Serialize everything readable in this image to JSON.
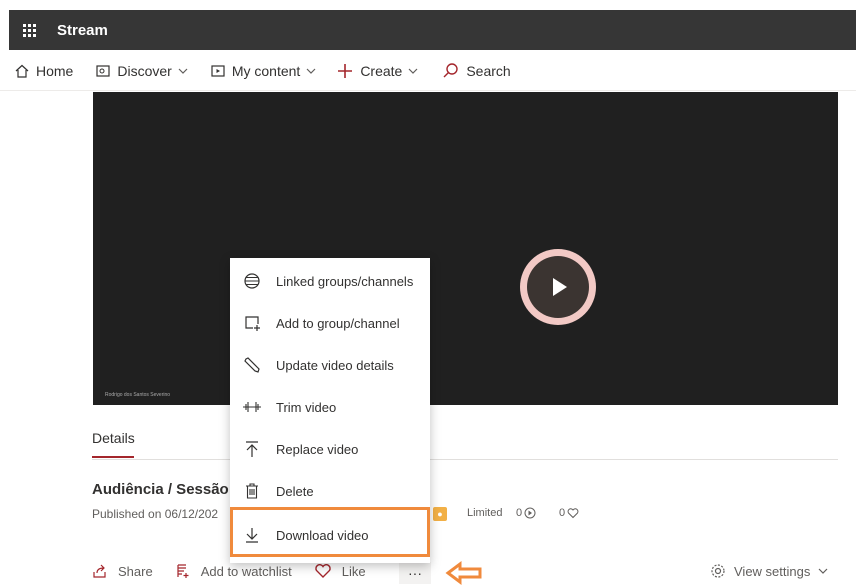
{
  "app": {
    "name": "Stream"
  },
  "nav": {
    "home": "Home",
    "discover": "Discover",
    "my_content": "My content",
    "create": "Create",
    "search": "Search"
  },
  "video": {
    "watermark": "Rodrigo dos Santos Severino"
  },
  "details": {
    "tab": "Details",
    "title": "Audiência / Sessão",
    "published": "Published on 06/12/202",
    "permission": "Limited",
    "views": "0",
    "likes": "0"
  },
  "menu": {
    "items": [
      "Linked groups/channels",
      "Add to group/channel",
      "Update video details",
      "Trim video",
      "Replace video",
      "Delete",
      "Download video"
    ]
  },
  "actions": {
    "share": "Share",
    "watchlist": "Add to watchlist",
    "like": "Like",
    "more": "···",
    "view_settings": "View settings"
  },
  "colors": {
    "topbar": "#363636",
    "accent": "#a4262c",
    "highlight": "#f08a3c"
  }
}
